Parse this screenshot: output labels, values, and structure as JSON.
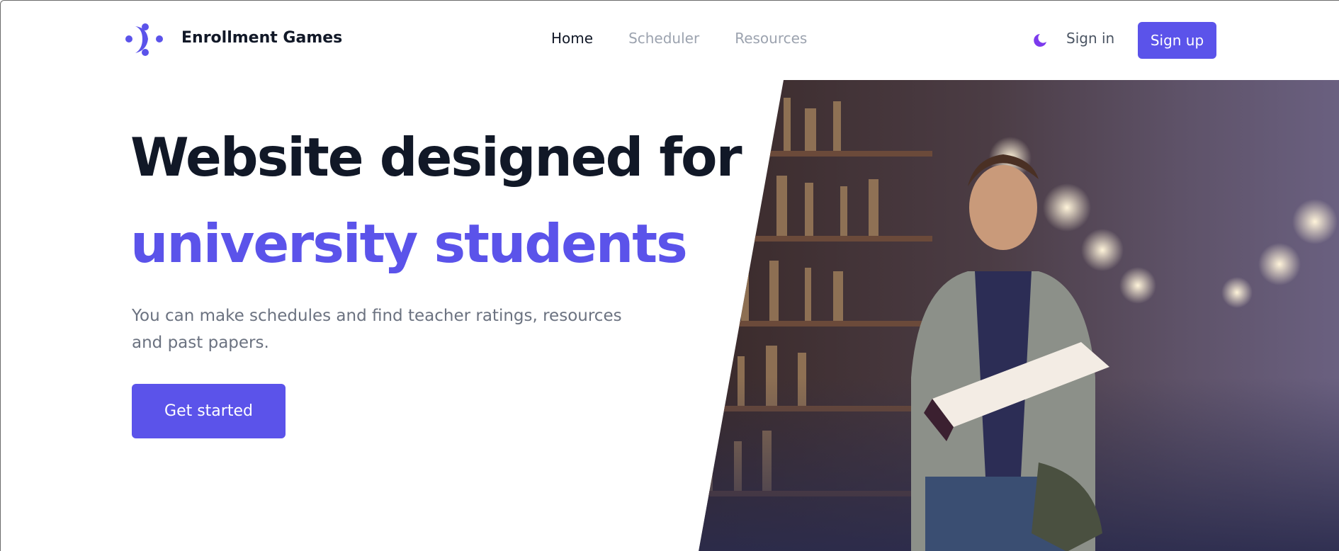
{
  "header": {
    "brand": "Enrollment Games",
    "logo_icon": "dots-arrow-logo",
    "nav": [
      {
        "label": "Home",
        "active": true
      },
      {
        "label": "Scheduler",
        "active": false
      },
      {
        "label": "Resources",
        "active": false
      }
    ],
    "theme_icon": "moon-icon",
    "sign_in_label": "Sign in",
    "sign_up_label": "Sign up"
  },
  "hero": {
    "title_line1": "Website designed for",
    "title_line2": "university students",
    "subtitle": "You can make schedules and find teacher ratings, resources and past papers.",
    "cta_label": "Get started",
    "image_subject": "student-reading-book-in-library"
  },
  "colors": {
    "accent": "#5b53ea",
    "heading": "#111827",
    "muted": "#6b7280",
    "nav_inactive": "#9ca3af"
  }
}
